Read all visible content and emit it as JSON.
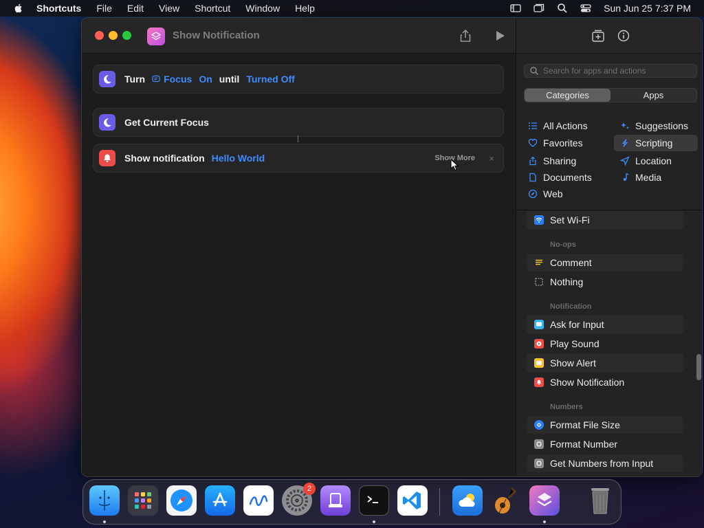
{
  "menubar": {
    "app_name": "Shortcuts",
    "items": [
      "File",
      "Edit",
      "View",
      "Shortcut",
      "Window",
      "Help"
    ],
    "clock": "Sun Jun 25  7:37 PM",
    "status_icons": [
      "sidebar-icon",
      "window-icon",
      "search-icon",
      "control-center-icon"
    ]
  },
  "window": {
    "title": "Show Notification"
  },
  "actions": [
    {
      "label": "Turn",
      "token1": "Focus",
      "token2": "On",
      "word": "until",
      "token3": "Turned Off"
    },
    {
      "label": "Get Current Focus"
    },
    {
      "label": "Show notification",
      "token": "Hello World",
      "show_more": "Show More",
      "close": "×"
    }
  ],
  "panel": {
    "search_placeholder": "Search for apps and actions",
    "tabs": [
      "Categories",
      "Apps"
    ],
    "categories_left": [
      "All Actions",
      "Favorites",
      "Sharing",
      "Documents",
      "Web"
    ],
    "categories_right": [
      "Suggestions",
      "Scripting",
      "Location",
      "Media"
    ],
    "list": {
      "set_wifi": "Set Wi-Fi",
      "section_noops": "No-ops",
      "comment": "Comment",
      "nothing": "Nothing",
      "section_notification": "Notification",
      "ask_for_input": "Ask for Input",
      "play_sound": "Play Sound",
      "show_alert": "Show Alert",
      "show_notification": "Show Notification",
      "section_numbers": "Numbers",
      "format_file_size": "Format File Size",
      "format_number": "Format Number",
      "get_numbers": "Get Numbers from Input"
    }
  },
  "dock": {
    "apps": [
      "Finder",
      "Launchpad",
      "Safari",
      "App Store",
      "Freeform",
      "System Settings",
      "Apple Configurator",
      "Terminal",
      "Visual Studio Code",
      "Weather",
      "GarageBand",
      "Shortcuts",
      "Trash"
    ],
    "settings_badge": "2"
  },
  "colors": {
    "accent": "#3f8cff",
    "focus_icon": "#6b5ce7",
    "notification_icon": "#ee4b4b"
  }
}
